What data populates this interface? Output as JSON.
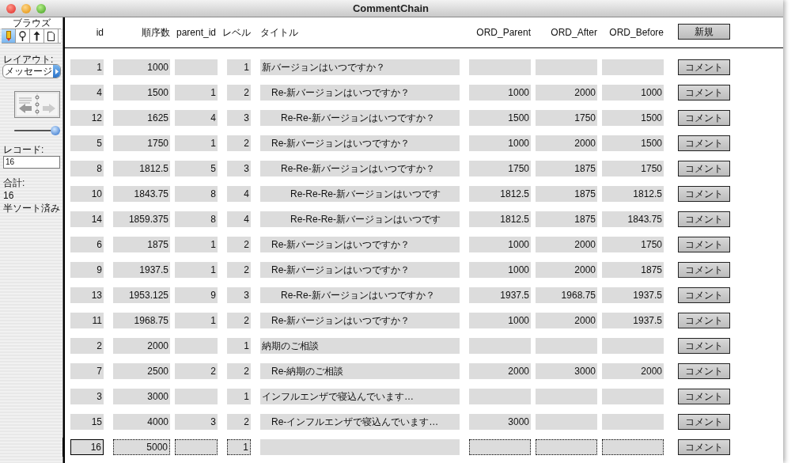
{
  "window": {
    "title": "CommentChain"
  },
  "sidebar": {
    "mode_label": "ブラウズ",
    "tools": [
      {
        "kind": "pencil",
        "selected": true
      },
      {
        "kind": "magnifier",
        "selected": false
      },
      {
        "kind": "arrow",
        "selected": false
      },
      {
        "kind": "page",
        "selected": false
      }
    ],
    "layout_label": "レイアウト:",
    "layout_value": "メッセージ",
    "slider": {
      "level": 1
    },
    "record_label": "レコード:",
    "record_value": "16",
    "total_label": "合計:",
    "total_value": "16",
    "sort_status": "半ソート済み"
  },
  "table": {
    "columns": [
      "id",
      "順序数",
      "parent_id",
      "レベル",
      "タイトル",
      "ORD_Parent",
      "ORD_After",
      "ORD_Before"
    ],
    "new_button": "新規",
    "rows": [
      {
        "cells": [
          "1",
          "1000",
          "",
          "1",
          "新バージョンはいつですか？",
          "",
          "",
          ""
        ],
        "button": "コメント",
        "selected": false
      },
      {
        "cells": [
          "4",
          "1500",
          "1",
          "2",
          "Re-新バージョンはいつですか？",
          "1000",
          "2000",
          "1000"
        ],
        "button": "コメント",
        "selected": false
      },
      {
        "cells": [
          "12",
          "1625",
          "4",
          "3",
          "Re-Re-新バージョンはいつですか？",
          "1500",
          "1750",
          "1500"
        ],
        "button": "コメント",
        "selected": false
      },
      {
        "cells": [
          "5",
          "1750",
          "1",
          "2",
          "Re-新バージョンはいつですか？",
          "1000",
          "2000",
          "1500"
        ],
        "button": "コメント",
        "selected": false
      },
      {
        "cells": [
          "8",
          "1812.5",
          "5",
          "3",
          "Re-Re-新バージョンはいつですか？",
          "1750",
          "1875",
          "1750"
        ],
        "button": "コメント",
        "selected": false
      },
      {
        "cells": [
          "10",
          "1843.75",
          "8",
          "4",
          "Re-Re-Re-新バージョンはいつです",
          "1812.5",
          "1875",
          "1812.5"
        ],
        "button": "コメント",
        "selected": false
      },
      {
        "cells": [
          "14",
          "1859.375",
          "8",
          "4",
          "Re-Re-Re-新バージョンはいつです",
          "1812.5",
          "1875",
          "1843.75"
        ],
        "button": "コメント",
        "selected": false
      },
      {
        "cells": [
          "6",
          "1875",
          "1",
          "2",
          "Re-新バージョンはいつですか？",
          "1000",
          "2000",
          "1750"
        ],
        "button": "コメント",
        "selected": false
      },
      {
        "cells": [
          "9",
          "1937.5",
          "1",
          "2",
          "Re-新バージョンはいつですか？",
          "1000",
          "2000",
          "1875"
        ],
        "button": "コメント",
        "selected": false
      },
      {
        "cells": [
          "13",
          "1953.125",
          "9",
          "3",
          "Re-Re-新バージョンはいつですか？",
          "1937.5",
          "1968.75",
          "1937.5"
        ],
        "button": "コメント",
        "selected": false
      },
      {
        "cells": [
          "11",
          "1968.75",
          "1",
          "2",
          "Re-新バージョンはいつですか？",
          "1000",
          "2000",
          "1937.5"
        ],
        "button": "コメント",
        "selected": false
      },
      {
        "cells": [
          "2",
          "2000",
          "",
          "1",
          "納期のご相談",
          "",
          "",
          ""
        ],
        "button": "コメント",
        "selected": false
      },
      {
        "cells": [
          "7",
          "2500",
          "2",
          "2",
          "Re-納期のご相談",
          "2000",
          "3000",
          "2000"
        ],
        "button": "コメント",
        "selected": false
      },
      {
        "cells": [
          "3",
          "3000",
          "",
          "1",
          "インフルエンザで寝込んでいます…",
          "",
          "",
          ""
        ],
        "button": "コメント",
        "selected": false
      },
      {
        "cells": [
          "15",
          "4000",
          "3",
          "2",
          "Re-インフルエンザで寝込んでいます…",
          "3000",
          "",
          ""
        ],
        "button": "コメント",
        "selected": false
      },
      {
        "cells": [
          "16",
          "5000",
          "",
          "1",
          "",
          "",
          "",
          ""
        ],
        "button": "コメント",
        "selected": true
      }
    ]
  }
}
